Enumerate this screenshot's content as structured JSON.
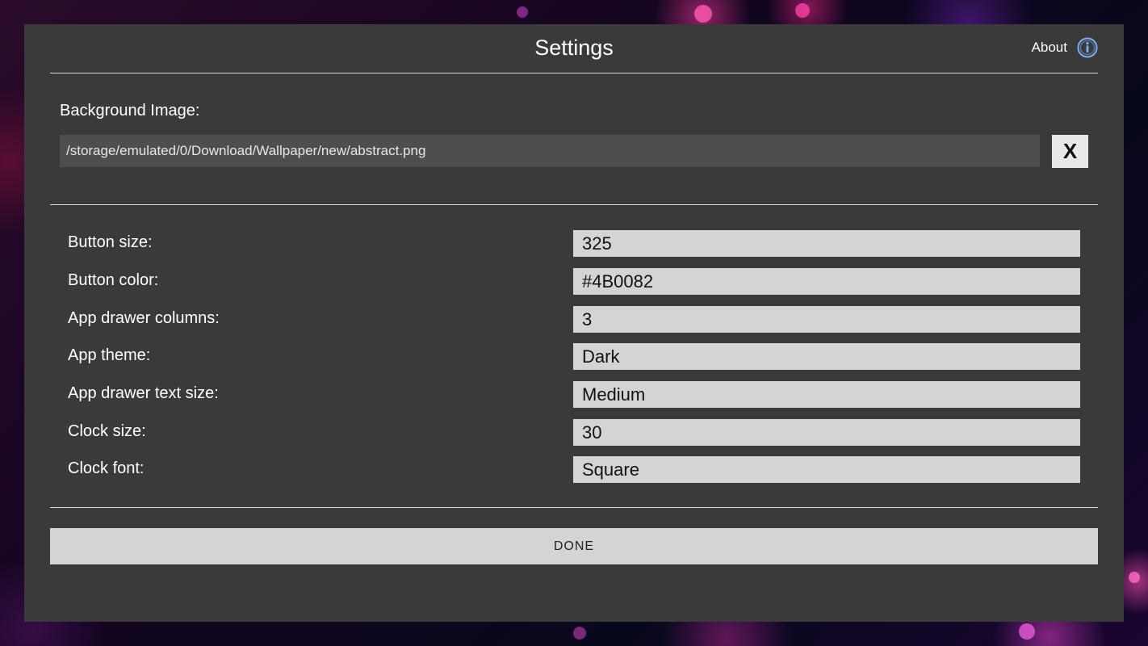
{
  "dialog": {
    "title": "Settings",
    "about_label": "About",
    "about_icon": "info-icon"
  },
  "background_image": {
    "label": "Background Image:",
    "path": "/storage/emulated/0/Download/Wallpaper/new/abstract.png",
    "clear_label": "X"
  },
  "settings": [
    {
      "label": "Button size:",
      "value": "325"
    },
    {
      "label": "Button color:",
      "value": "#4B0082"
    },
    {
      "label": "App drawer columns:",
      "value": "3"
    },
    {
      "label": "App theme:",
      "value": "Dark"
    },
    {
      "label": "App drawer text size:",
      "value": "Medium"
    },
    {
      "label": "Clock size:",
      "value": "30"
    },
    {
      "label": "Clock font:",
      "value": "Square"
    }
  ],
  "done_label": "DONE",
  "colors": {
    "dialog_background": "#3a3a3a",
    "field_background": "#d4d4d4",
    "path_field_background": "#4e4e4e",
    "info_icon": "#7ab0f0"
  }
}
